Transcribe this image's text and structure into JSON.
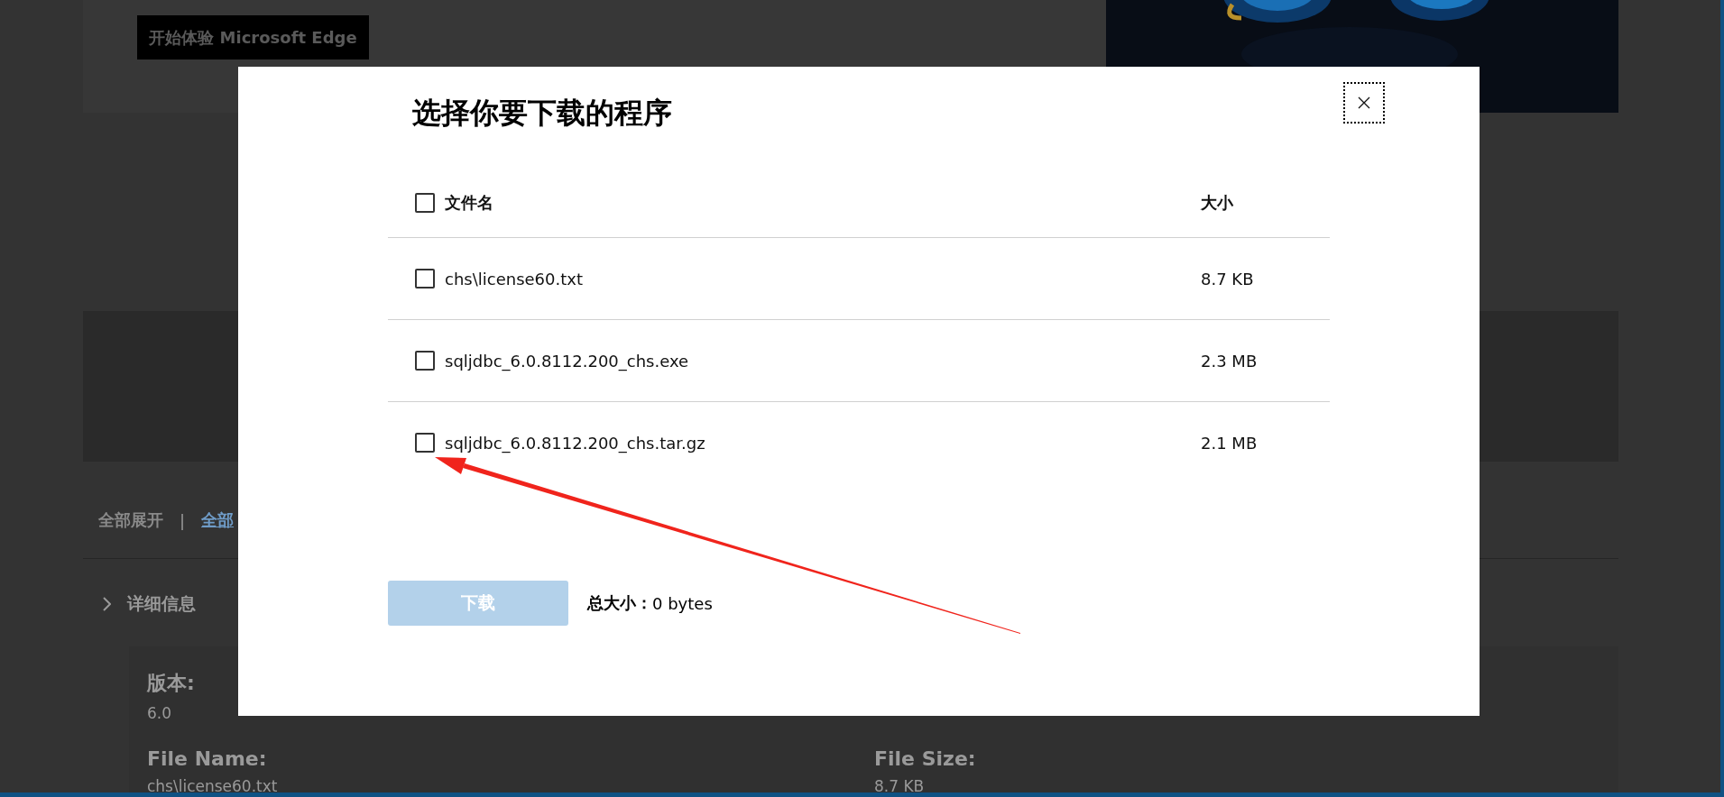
{
  "background_page": {
    "edge_button": "开始体验 Microsoft Edge",
    "expand_all": "全部展开",
    "separator": "|",
    "collapse_all": "全部",
    "details_toggle": "详细信息",
    "details": [
      {
        "label": "版本:",
        "value": "6.0"
      },
      {
        "label": "File Name:",
        "value": "chs\\license60.txt"
      },
      {
        "label": "File Size:",
        "value": "8.7 KB"
      }
    ]
  },
  "dialog": {
    "title": "选择你要下载的程序",
    "header": {
      "checked": false,
      "name": "文件名",
      "size": "大小"
    },
    "files": [
      {
        "name": "chs\\license60.txt",
        "size": "8.7 KB",
        "checked": false
      },
      {
        "name": "sqljdbc_6.0.8112.200_chs.exe",
        "size": "2.3 MB",
        "checked": false
      },
      {
        "name": "sqljdbc_6.0.8112.200_chs.tar.gz",
        "size": "2.1 MB",
        "checked": false
      }
    ],
    "download_button": {
      "label": "下载",
      "disabled": true
    },
    "total_label": "总大小：",
    "total_value": "0 bytes"
  }
}
